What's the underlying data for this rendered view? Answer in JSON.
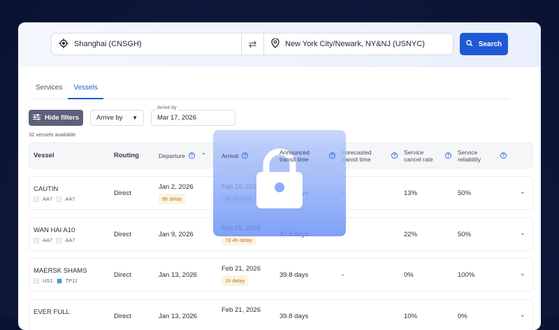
{
  "search": {
    "origin": "Shanghai (CNSGH)",
    "destination": "New York City/Newark, NY&NJ (USNYC)",
    "button": "Search"
  },
  "tabs": [
    {
      "label": "Services"
    },
    {
      "label": "Vessels"
    }
  ],
  "filters": {
    "hide_filters": "Hide filters",
    "arrive_by_select": "Arrive by",
    "date_label": "Arrive by",
    "date_value": "Mar 17, 2026"
  },
  "count": "32 vessels available",
  "columns": {
    "vessel": "Vessel",
    "routing": "Routing",
    "departure": "Departure",
    "arrival": "Arrival",
    "announced": "Announced transit time",
    "forecasted": "Forecasted transit time",
    "cancel": "Service cancel rate",
    "reliability": "Service reliability"
  },
  "rows": [
    {
      "vessel": "CAUTIN",
      "svc1": "AA7",
      "svc2": "AA7",
      "routing": "Direct",
      "departure": "Jan 2, 2026",
      "dep_delay": "8h delay",
      "arrival": "Feb 18, 2026",
      "arr_delay": "9d 3h delay",
      "announced": "47.5 days",
      "forecasted": "-",
      "cancel": "13%",
      "reliability": "50%"
    },
    {
      "vessel": "WAN HAI A10",
      "svc1": "AA7",
      "svc2": "AA7",
      "routing": "Direct",
      "departure": "Jan 9, 2026",
      "dep_delay": "",
      "arrival": "Feb 25, 2026",
      "arr_delay": "7d 4h delay",
      "announced": "47.5 days",
      "forecasted": "-",
      "cancel": "22%",
      "reliability": "50%"
    },
    {
      "vessel": "MAERSK SHAMS",
      "svc1": "US1",
      "svc2": "TP11",
      "routing": "Direct",
      "departure": "Jan 13, 2026",
      "dep_delay": "",
      "arrival": "Feb 21, 2026",
      "arr_delay": "1h delay",
      "announced": "39.8 days",
      "forecasted": "-",
      "cancel": "0%",
      "reliability": "100%"
    },
    {
      "vessel": "EVER FULL",
      "svc1": "",
      "svc2": "",
      "routing": "Direct",
      "departure": "Jan 13, 2026",
      "dep_delay": "",
      "arrival": "Feb 21, 2026",
      "arr_delay": "",
      "announced": "39.8 days",
      "forecasted": "",
      "cancel": "10%",
      "reliability": "0%"
    }
  ]
}
